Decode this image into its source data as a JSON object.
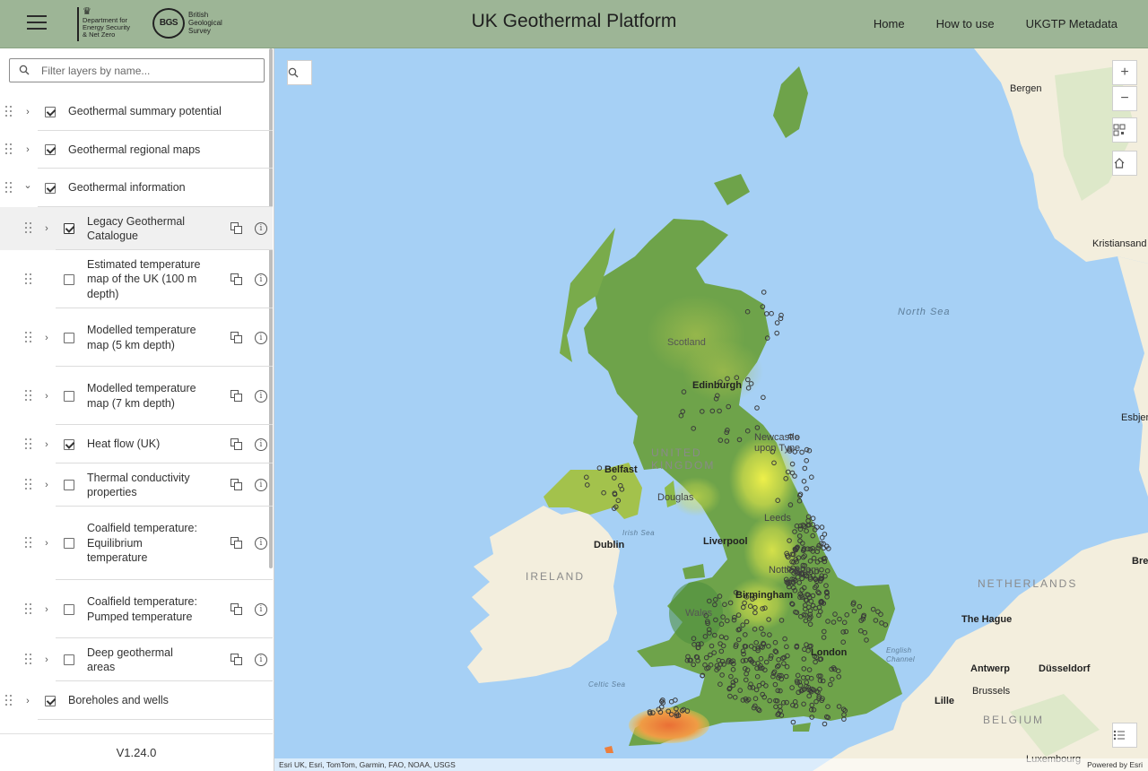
{
  "header": {
    "menu_icon": "hamburger-icon",
    "gov_logo_text": [
      "Department for",
      "Energy Security",
      "& Net Zero"
    ],
    "bgs_mark": "BGS",
    "bgs_logo_text": [
      "British",
      "Geological",
      "Survey"
    ],
    "title": "UK Geothermal Platform",
    "nav": [
      "Home",
      "How to use",
      "UKGTP Metadata"
    ]
  },
  "sidebar": {
    "filter_placeholder": "Filter layers by name...",
    "layers": [
      {
        "label": "Geothermal summary potential",
        "checked": true,
        "expand": "collapsed"
      },
      {
        "label": "Geothermal regional maps",
        "checked": true,
        "expand": "collapsed"
      },
      {
        "label": "Geothermal information",
        "checked": true,
        "expand": "expanded"
      },
      {
        "label": "Legacy Geothermal Catalogue",
        "checked": true,
        "expand": "collapsed",
        "sub": true
      },
      {
        "label": "Estimated temperature map of the UK (100 m depth)",
        "checked": false,
        "expand": "none",
        "sub": true
      },
      {
        "label": "Modelled temperature map (5 km depth)",
        "checked": false,
        "expand": "collapsed",
        "sub": true
      },
      {
        "label": "Modelled temperature map (7 km depth)",
        "checked": false,
        "expand": "collapsed",
        "sub": true
      },
      {
        "label": "Heat flow (UK)",
        "checked": true,
        "expand": "collapsed",
        "sub": true
      },
      {
        "label": "Thermal conductivity properties",
        "checked": false,
        "expand": "collapsed",
        "sub": true
      },
      {
        "label": "Coalfield temperature: Equilibrium temperature",
        "checked": false,
        "expand": "collapsed",
        "sub": true
      },
      {
        "label": "Coalfield temperature: Pumped temperature",
        "checked": false,
        "expand": "collapsed",
        "sub": true
      },
      {
        "label": "Deep geothermal areas",
        "checked": false,
        "expand": "collapsed",
        "sub": true
      },
      {
        "label": "Boreholes and wells",
        "checked": true,
        "expand": "collapsed"
      }
    ],
    "version": "V1.24.0"
  },
  "map": {
    "labels": {
      "bergen": "Bergen",
      "north_sea": "North Sea",
      "kristiansand": "Kristiansand",
      "esbjerg": "Esbjer",
      "scotland": "Scotland",
      "edinburgh": "Edinburgh",
      "newcastle": "Newcastle upon Tyne",
      "united_kingdom": "UNITED KINGDOM",
      "belfast": "Belfast",
      "douglas": "Douglas",
      "irish_sea": "Irish Sea",
      "leeds": "Leeds",
      "dublin": "Dublin",
      "liverpool": "Liverpool",
      "ireland": "IRELAND",
      "nottingham": "Nottingham",
      "birmingham": "Birmingham",
      "netherlands": "NETHERLANDS",
      "wales": "Wales",
      "the_hague": "The Hague",
      "london": "London",
      "english_channel": "English Channel",
      "antwerp": "Antwerp",
      "dusseldorf": "Düsseldorf",
      "celtic_sea": "Celtic Sea",
      "brussels": "Brussels",
      "lille": "Lille",
      "belgium": "BELGIUM",
      "bremen": "Bre",
      "luxembourg": "Luxembourg"
    },
    "attribution": "Esri UK, Esri, TomTom, Garmin, FAO, NOAA, USGS",
    "powered_by": "Powered by Esri",
    "controls": [
      "zoom-in",
      "zoom-out",
      "qr-code",
      "home",
      "legend"
    ],
    "colors": {
      "sea": "#a6d0f5",
      "land": "#f4efe1",
      "cool": "#5e9b49",
      "warm": "#e8e54a",
      "hot": "#ec7f3d"
    }
  }
}
